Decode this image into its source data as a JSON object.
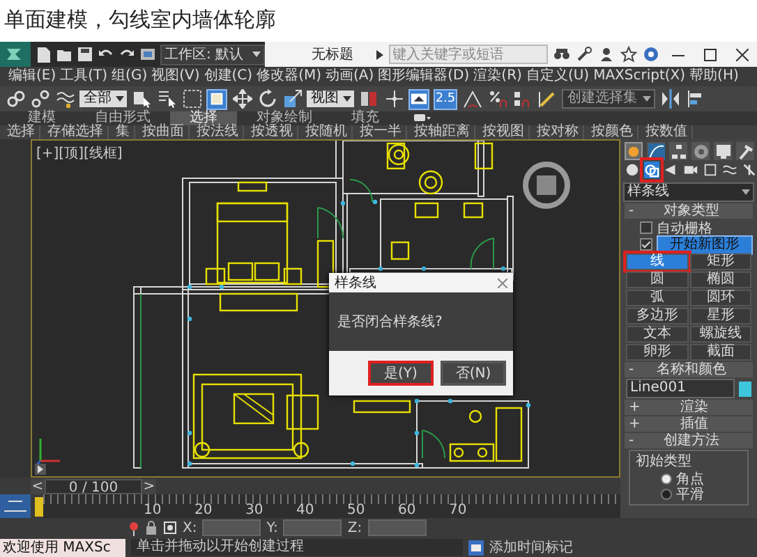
{
  "heading": "单面建模，勾线室内墙体轮廓",
  "title_bar": {
    "workspace": "工作区: 默认",
    "title": "无标题",
    "search": {
      "placeholder": "键入关键字或短语"
    }
  },
  "menu": [
    "编辑(E)",
    "工具(T)",
    "组(G)",
    "视图(V)",
    "创建(C)",
    "修改器(M)",
    "动画(A)",
    "图形编辑器(D)",
    "渲染(R)",
    "自定义(U)",
    "MAXScript(X)",
    "帮助(H)"
  ],
  "toolbar": [
    {
      "kind": "icon",
      "active": false
    },
    {
      "kind": "icon",
      "active": false
    },
    {
      "kind": "icon",
      "active": false
    },
    {
      "kind": "dropdown",
      "value": "全部"
    },
    {
      "kind": "icon",
      "active": false
    },
    {
      "kind": "icon",
      "active": false
    },
    {
      "kind": "icon",
      "active": false
    },
    {
      "kind": "icon",
      "active": true
    },
    {
      "kind": "icon",
      "active": false
    },
    {
      "kind": "icon",
      "active": false
    },
    {
      "kind": "icon",
      "active": false
    },
    {
      "kind": "dropdown",
      "value": "视图"
    },
    {
      "kind": "icon",
      "active": false
    },
    {
      "kind": "icon",
      "active": false
    },
    {
      "kind": "icon",
      "active": true
    },
    {
      "kind": "snap",
      "label": "2.5",
      "active": true
    },
    {
      "kind": "icon",
      "active": false
    },
    {
      "kind": "icon",
      "active": false
    },
    {
      "kind": "icon",
      "active": false
    },
    {
      "kind": "icon",
      "active": false
    },
    {
      "kind": "dropdown",
      "value": "创建选择集"
    },
    {
      "kind": "icon",
      "active": false
    },
    {
      "kind": "icon",
      "active": false
    }
  ],
  "ribbon": {
    "tabs": [
      {
        "label": "建模",
        "selected": false
      },
      {
        "label": "自由形式",
        "selected": false
      },
      {
        "label": "选择",
        "selected": true
      },
      {
        "label": "对象绘制",
        "selected": false
      },
      {
        "label": "填充",
        "selected": false
      }
    ],
    "items": [
      "选择",
      "存储选择",
      "集",
      "按曲面",
      "按法线",
      "按透视",
      "按随机",
      "按一半",
      "按轴距离",
      "按视图",
      "按对称",
      "按颜色",
      "按数值"
    ]
  },
  "viewport": {
    "label": "[+][顶][线框]"
  },
  "dialog": {
    "title": "样条线",
    "message": "是否闭合样条线?",
    "buttons": [
      {
        "label": "是(Y)",
        "highlighted": true
      },
      {
        "label": "否(N)",
        "highlighted": false
      }
    ]
  },
  "command_panel": {
    "tabs": [
      {
        "selected": true
      },
      {
        "selected": false
      },
      {
        "selected": false
      },
      {
        "selected": false
      },
      {
        "selected": false
      },
      {
        "selected": false
      }
    ],
    "categories": [
      {
        "selected": false,
        "highlighted": false
      },
      {
        "selected": true,
        "highlighted": true
      },
      {
        "selected": false,
        "highlighted": false
      },
      {
        "selected": false,
        "highlighted": false
      },
      {
        "selected": false,
        "highlighted": false
      },
      {
        "selected": false,
        "highlighted": false
      },
      {
        "selected": false,
        "highlighted": false
      }
    ],
    "dropdown": "样条线",
    "object_type": {
      "toggle": "-",
      "title": "对象类型",
      "autogrid": {
        "label": "自动栅格",
        "checked": false
      },
      "start_new_shape": {
        "label": "开始新图形",
        "checked": true
      },
      "buttons": [
        {
          "label": "线",
          "selected": true,
          "highlighted": true
        },
        {
          "label": "矩形",
          "selected": false,
          "highlighted": false
        },
        {
          "label": "圆",
          "selected": false,
          "highlighted": false
        },
        {
          "label": "椭圆",
          "selected": false,
          "highlighted": false
        },
        {
          "label": "弧",
          "selected": false,
          "highlighted": false
        },
        {
          "label": "圆环",
          "selected": false,
          "highlighted": false
        },
        {
          "label": "多边形",
          "selected": false,
          "highlighted": false
        },
        {
          "label": "星形",
          "selected": false,
          "highlighted": false
        },
        {
          "label": "文本",
          "selected": false,
          "highlighted": false
        },
        {
          "label": "螺旋线",
          "selected": false,
          "highlighted": false
        },
        {
          "label": "卵形",
          "selected": false,
          "highlighted": false
        },
        {
          "label": "截面",
          "selected": false,
          "highlighted": false
        }
      ]
    },
    "name_color": {
      "toggle": "-",
      "title": "名称和颜色",
      "name": "Line001",
      "color": "#3ec6dc"
    },
    "rollouts": [
      {
        "toggle": "+",
        "title": "渲染"
      },
      {
        "toggle": "+",
        "title": "插值"
      },
      {
        "toggle": "-",
        "title": "创建方法"
      }
    ],
    "initial_type": {
      "title": "初始类型",
      "options": [
        {
          "label": "角点",
          "selected": true
        },
        {
          "label": "平滑",
          "selected": false
        }
      ]
    }
  },
  "timeline": {
    "level": 0,
    "prev": "<",
    "frame": "0 / 100",
    "next": ">",
    "ticks": [
      "10",
      "20",
      "30",
      "40",
      "50",
      "60",
      "70"
    ]
  },
  "status": {
    "coords": [
      "X:",
      "Y:",
      "Z:"
    ],
    "welcome": "欢迎使用 MAXSc",
    "prompt": "单击并拖动以开始创建过程",
    "time_tag": "添加时间标记"
  }
}
